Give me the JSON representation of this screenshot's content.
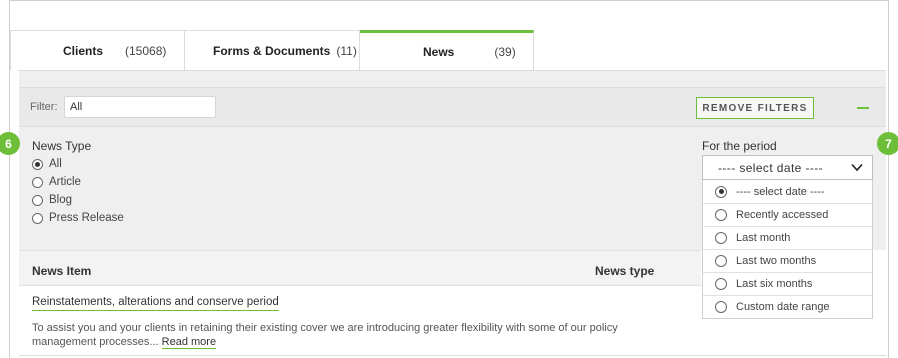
{
  "tabs": [
    {
      "label": "Clients",
      "count": "(15068)"
    },
    {
      "label": "Forms & Documents",
      "count": "(11)"
    },
    {
      "label": "News",
      "count": "(39)"
    }
  ],
  "filter": {
    "label": "Filter:",
    "value": "All"
  },
  "remove_filters_label": "REMOVE FILTERS",
  "news_type": {
    "title": "News Type",
    "options": [
      "All",
      "Article",
      "Blog",
      "Press Release"
    ],
    "selected": "All"
  },
  "period": {
    "title": "For the period",
    "selected_label": "---- select date ----",
    "options": [
      "---- select date ----",
      "Recently accessed",
      "Last month",
      "Last two months",
      "Last six months",
      "Custom date range"
    ]
  },
  "badges": [
    "6",
    "7"
  ],
  "table": {
    "headers": [
      "News Item",
      "News type"
    ],
    "rows": [
      {
        "title": "Reinstatements, alterations and conserve period",
        "description": "To assist you and your clients in retaining their existing cover we are introducing greater flexibility with some of our policy management processes...",
        "link": "Read more"
      }
    ]
  },
  "colors": {
    "accent": "#6dbf3a",
    "panel": "#efefef"
  }
}
